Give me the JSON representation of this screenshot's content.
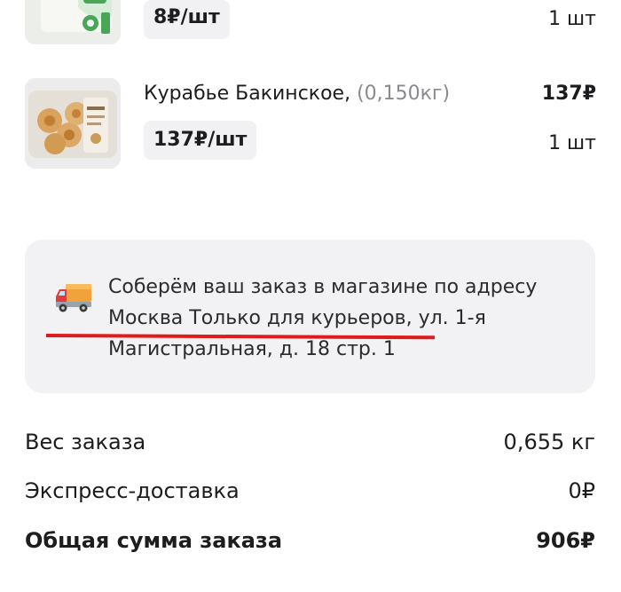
{
  "products": [
    {
      "name": "",
      "weight": "",
      "unit_price": "8₽/шт",
      "total": "",
      "quantity": "1 шт"
    },
    {
      "name": "Курабье Бакинское, ",
      "weight": "(0,150кг)",
      "unit_price": "137₽/шт",
      "total": "137₽",
      "quantity": "1 шт"
    }
  ],
  "pickup_notice": {
    "icon": "delivery-truck-icon",
    "line1": "Соберём ваш заказ в магазине по адресу",
    "line2": "Москва Только для курьеров, ул. 1-я",
    "line3": "Магистральная, д. 18 стр. 1"
  },
  "summary": {
    "weight_label": "Вес заказа",
    "weight_value": "0,655 кг",
    "delivery_label": "Экспресс-доставка",
    "delivery_value": "0₽",
    "total_label": "Общая сумма заказа",
    "total_value": "906₽"
  },
  "colors": {
    "accent_underline": "#e01b1b",
    "card_background": "#f2f2f4",
    "pill_background": "#f1f1f3"
  }
}
